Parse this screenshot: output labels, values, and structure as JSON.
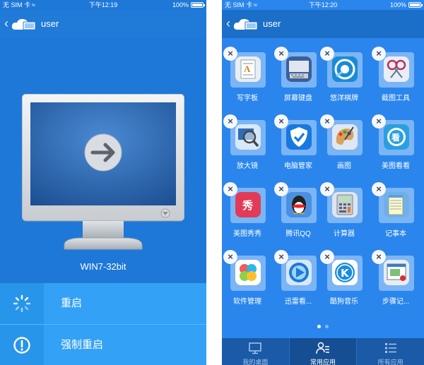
{
  "left_screen": {
    "status_bar": {
      "carrier": "无 SIM 卡",
      "time": "下午12:19",
      "battery": "100%"
    },
    "nav": {
      "title": "user"
    },
    "os_label": "WIN7-32bit",
    "actions": [
      {
        "label": "重启",
        "icon": "restart-icon"
      },
      {
        "label": "强制重启",
        "icon": "alert-icon"
      }
    ]
  },
  "right_screen": {
    "status_bar": {
      "carrier": "无 SIM 卡",
      "time": "下午12:20",
      "battery": "100%"
    },
    "nav": {
      "title": "user"
    },
    "apps": [
      {
        "label": "写字板",
        "icon": "wordpad-icon"
      },
      {
        "label": "屏幕键盘",
        "icon": "keyboard-icon"
      },
      {
        "label": "悠洋棋牌",
        "icon": "game-icon"
      },
      {
        "label": "截图工具",
        "icon": "snipping-icon"
      },
      {
        "label": "放大镜",
        "icon": "magnifier-icon"
      },
      {
        "label": "电脑管家",
        "icon": "shield-icon"
      },
      {
        "label": "画图",
        "icon": "paint-icon"
      },
      {
        "label": "美图看看",
        "icon": "viewer-icon"
      },
      {
        "label": "美图秀秀",
        "icon": "meitu-icon"
      },
      {
        "label": "腾讯QQ",
        "icon": "qq-icon"
      },
      {
        "label": "计算器",
        "icon": "calculator-icon"
      },
      {
        "label": "记事本",
        "icon": "notepad-icon"
      },
      {
        "label": "软件管理",
        "icon": "software-manager-icon"
      },
      {
        "label": "迅雷看...",
        "icon": "xunlei-icon"
      },
      {
        "label": "酷狗音乐",
        "icon": "kugou-icon"
      },
      {
        "label": "步骤记...",
        "icon": "steps-recorder-icon"
      }
    ],
    "delete_symbol": "×",
    "page_indicator": {
      "pages": 2,
      "current": 1
    },
    "tabs": [
      {
        "label": "我的桌面",
        "icon": "desktop-icon",
        "active": false
      },
      {
        "label": "常用应用",
        "icon": "user-list-icon",
        "active": true
      },
      {
        "label": "所有应用",
        "icon": "list-icon",
        "active": false
      }
    ]
  },
  "colors": {
    "left_bg": "#1e78d8",
    "right_bg": "#2a86ec",
    "action_bg": "#33a1f5",
    "tabbar_bg": "#1a5aa7"
  }
}
